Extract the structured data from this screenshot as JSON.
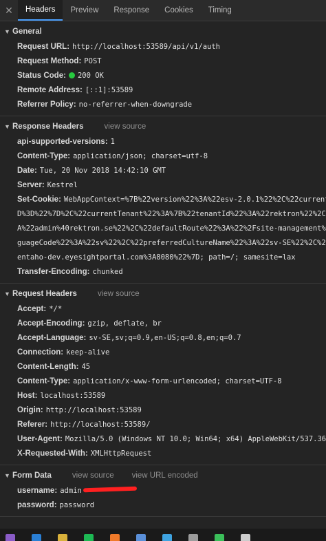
{
  "tabs": {
    "close_symbol": "✕",
    "items": [
      {
        "label": "Headers"
      },
      {
        "label": "Preview"
      },
      {
        "label": "Response"
      },
      {
        "label": "Cookies"
      },
      {
        "label": "Timing"
      }
    ]
  },
  "general": {
    "title": "General",
    "rows": [
      {
        "key": "Request URL",
        "value": "http://localhost:53589/api/v1/auth"
      },
      {
        "key": "Request Method",
        "value": "POST"
      },
      {
        "key": "Status Code",
        "value": "200 OK"
      },
      {
        "key": "Remote Address",
        "value": "[::1]:53589"
      },
      {
        "key": "Referrer Policy",
        "value": "no-referrer-when-downgrade"
      }
    ]
  },
  "response_headers": {
    "title": "Response Headers",
    "view_source": "view source",
    "rows": [
      {
        "key": "api-supported-versions",
        "value": "1"
      },
      {
        "key": "Content-Type",
        "value": "application/json; charset=utf-8"
      },
      {
        "key": "Date",
        "value": "Tue, 20 Nov 2018 14:42:10 GMT"
      },
      {
        "key": "Server",
        "value": "Kestrel"
      },
      {
        "key": "Set-Cookie",
        "value": "WebAppContext=%7B%22version%22%3A%22esv-2.0.1%22%2C%22currentI"
      }
    ],
    "set_cookie_continued": [
      "D%3D%22%7D%2C%22currentTenant%22%3A%7B%22tenantId%22%3A%22rektron%22%2C%",
      "A%22admin%40rektron.se%22%2C%22defaultRoute%22%3A%22%2Fsite-management%2",
      "guageCode%22%3A%22sv%22%2C%22preferredCultureName%22%3A%22sv-SE%22%2C%22",
      "entaho-dev.eyesightportal.com%3A8080%22%7D; path=/; samesite=lax"
    ],
    "rows_after": [
      {
        "key": "Transfer-Encoding",
        "value": "chunked"
      }
    ]
  },
  "request_headers": {
    "title": "Request Headers",
    "view_source": "view source",
    "rows": [
      {
        "key": "Accept",
        "value": "*/*"
      },
      {
        "key": "Accept-Encoding",
        "value": "gzip, deflate, br"
      },
      {
        "key": "Accept-Language",
        "value": "sv-SE,sv;q=0.9,en-US;q=0.8,en;q=0.7"
      },
      {
        "key": "Connection",
        "value": "keep-alive"
      },
      {
        "key": "Content-Length",
        "value": "45"
      },
      {
        "key": "Content-Type",
        "value": "application/x-www-form-urlencoded; charset=UTF-8"
      },
      {
        "key": "Host",
        "value": "localhost:53589"
      },
      {
        "key": "Origin",
        "value": "http://localhost:53589"
      },
      {
        "key": "Referer",
        "value": "http://localhost:53589/"
      },
      {
        "key": "User-Agent",
        "value": "Mozilla/5.0 (Windows NT 10.0; Win64; x64) AppleWebKit/537.36"
      },
      {
        "key": "X-Requested-With",
        "value": "XMLHttpRequest"
      }
    ]
  },
  "form_data": {
    "title": "Form Data",
    "view_source": "view source",
    "view_url_encoded": "view URL encoded",
    "rows": [
      {
        "key": "username",
        "value": "admin"
      },
      {
        "key": "password",
        "value": "password"
      }
    ]
  },
  "colors": {
    "status_ok": "#27c93f",
    "redaction": "#ff2020",
    "active_tab_underline": "#4aa0ff"
  }
}
